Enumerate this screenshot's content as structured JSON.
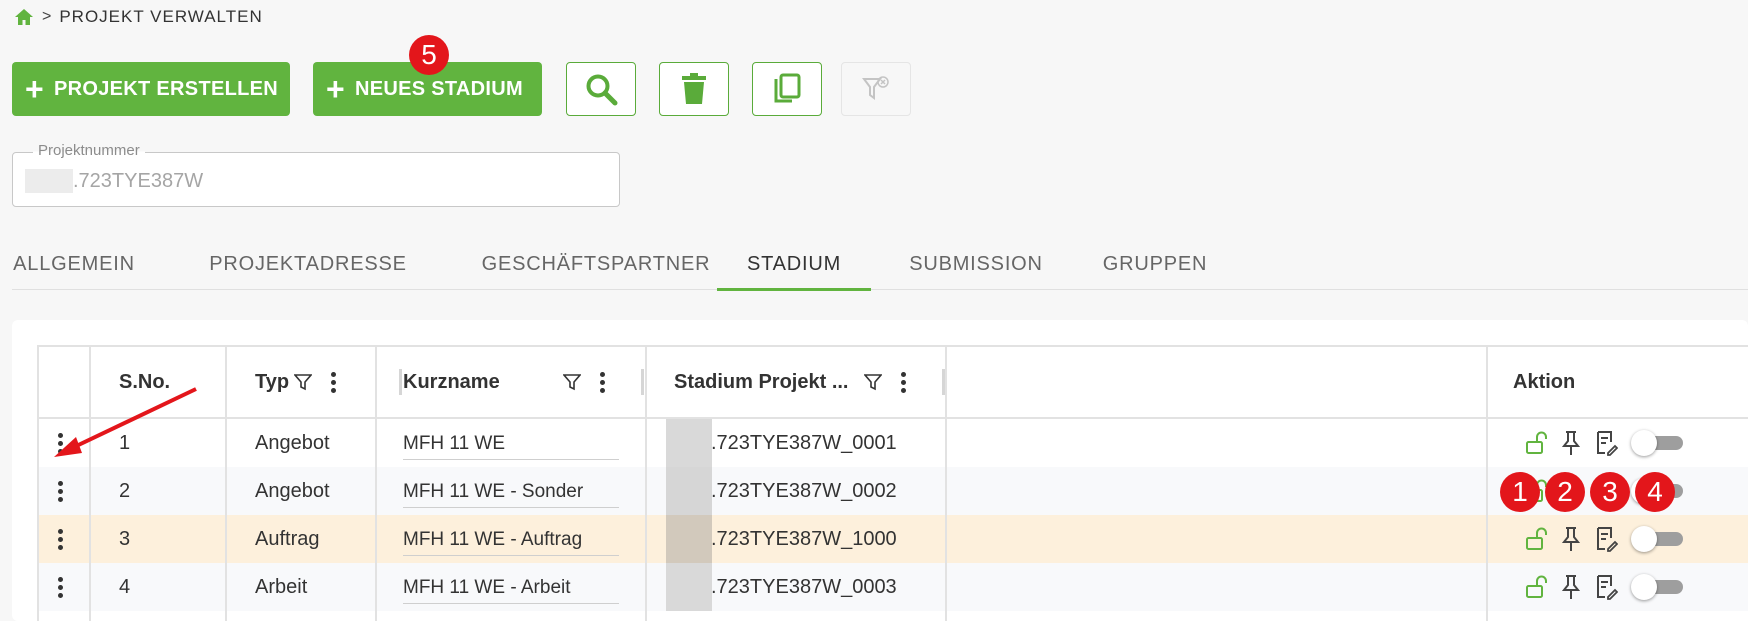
{
  "breadcrumb": {
    "separator": ">",
    "current": "PROJEKT VERWALTEN"
  },
  "toolbar": {
    "create_project_label": "PROJEKT ERSTELLEN",
    "new_stage_label": "NEUES STADIUM",
    "plus": "+"
  },
  "badges": [
    "1",
    "2",
    "3",
    "4",
    "5"
  ],
  "project_field": {
    "label": "Projektnummer",
    "value": ".723TYE387W"
  },
  "tabs": [
    "ALLGEMEIN",
    "PROJEKTADRESSE",
    "GESCHÄFTSPARTNER",
    "STADIUM",
    "SUBMISSION",
    "GRUPPEN"
  ],
  "active_tab": "STADIUM",
  "table": {
    "headers": {
      "sno": "S.No.",
      "typ": "Typ",
      "kurzname": "Kurzname",
      "stadium": "Stadium Projekt ...",
      "aktion": "Aktion"
    },
    "rows": [
      {
        "sno": "1",
        "typ": "Angebot",
        "kurzname": "MFH 11 WE",
        "stadium": ".723TYE387W_0001"
      },
      {
        "sno": "2",
        "typ": "Angebot",
        "kurzname": "MFH 11 WE - Sonder",
        "stadium": ".723TYE387W_0002"
      },
      {
        "sno": "3",
        "typ": "Auftrag",
        "kurzname": "MFH 11 WE - Auftrag",
        "stadium": ".723TYE387W_1000"
      },
      {
        "sno": "4",
        "typ": "Arbeit",
        "kurzname": "MFH 11 WE - Arbeit",
        "stadium": ".723TYE387W_0003"
      }
    ]
  },
  "colors": {
    "accent": "#61b43f",
    "badge": "#e3161b",
    "highlight_row": "#fdf0dc"
  }
}
